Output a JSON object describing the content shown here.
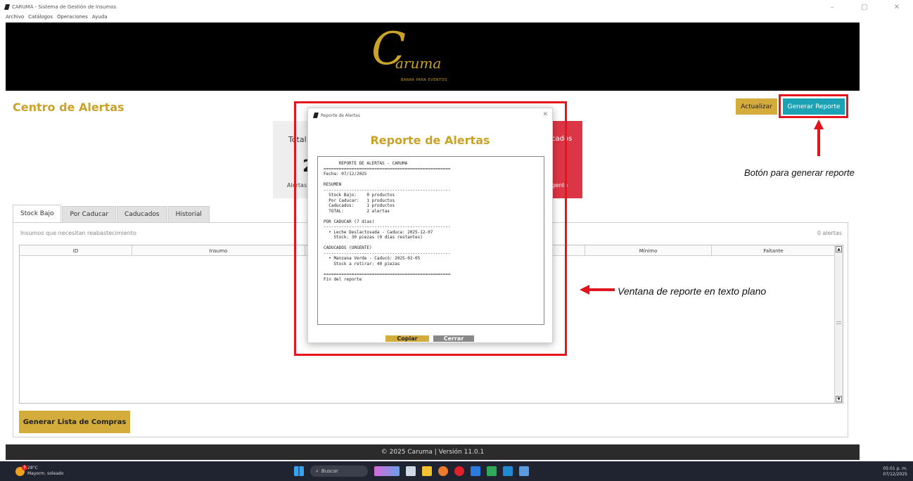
{
  "window": {
    "title": "CARUMA - Sistema de Gestión de Insumos",
    "controls": {
      "minimize": "–",
      "maximize": "▢",
      "close": "✕"
    }
  },
  "menu": [
    "Archivo",
    "Catálogos",
    "Operaciones",
    "Ayuda"
  ],
  "banner": {
    "logo_initial": "C",
    "logo_word": "aruma",
    "logo_tagline": "BARRA PARA EVENTOS"
  },
  "header": {
    "title": "Centro de Alertas",
    "refresh_label": "Actualizar",
    "report_label": "Generar Reporte"
  },
  "cards": {
    "total_label": "Total",
    "total_value": "2",
    "total_caption": "Alertas",
    "cad_label": "cados",
    "cad_caption": "gente"
  },
  "tabs": [
    "Stock Bajo",
    "Por Caducar",
    "Caducados",
    "Historial"
  ],
  "panel": {
    "caption": "Insumos que necesitan reabastecimiento",
    "count": "0 alertas",
    "columns": [
      "ID",
      "Insumo",
      "",
      "Mínimo",
      "Faltante"
    ]
  },
  "shopping_button": "Generar Lista de Compras",
  "footer": "© 2025 Caruma | Versión 11.0.1",
  "dialog": {
    "window_title": "Reporte de Alertas",
    "heading": "Reporte de Alertas",
    "report_lines": [
      "      REPORTE DE ALERTAS - CARUMA",
      "==================================================",
      "Fecha: 07/12/2025",
      "",
      "RESUMEN",
      "--------------------------------------------------",
      "  Stock Bajo:    0 productos",
      "  Por Caducar:   1 productos",
      "  Caducados:     1 productos",
      "  TOTAL:         2 alertas",
      "",
      "POR CADUCAR (7 días)",
      "--------------------------------------------------",
      "  • Leche Deslactosada - Caduca: 2025-12-07",
      "    Stock: 30 piezas (0 días restantes)",
      "",
      "CADUCADOS (URGENTE)",
      "--------------------------------------------------",
      "  • Manzana Verde - Caducó: 2025-02-05",
      "    Stock a retirar: 40 piezas",
      "",
      "==================================================",
      "Fin del reporte"
    ],
    "copy_label": "Copiar",
    "close_label": "Cerrar"
  },
  "annotations": {
    "report_button": "Botón para generar reporte",
    "report_window": "Ventana de reporte en texto plano",
    "highlight_color": "#e8141c"
  },
  "taskbar": {
    "temperature": "28°C",
    "weather": "Mayorm. soleado",
    "weather_badge": "3",
    "search_placeholder": "Buscar",
    "time": "05:01 p. m.",
    "date": "07/12/2025"
  }
}
